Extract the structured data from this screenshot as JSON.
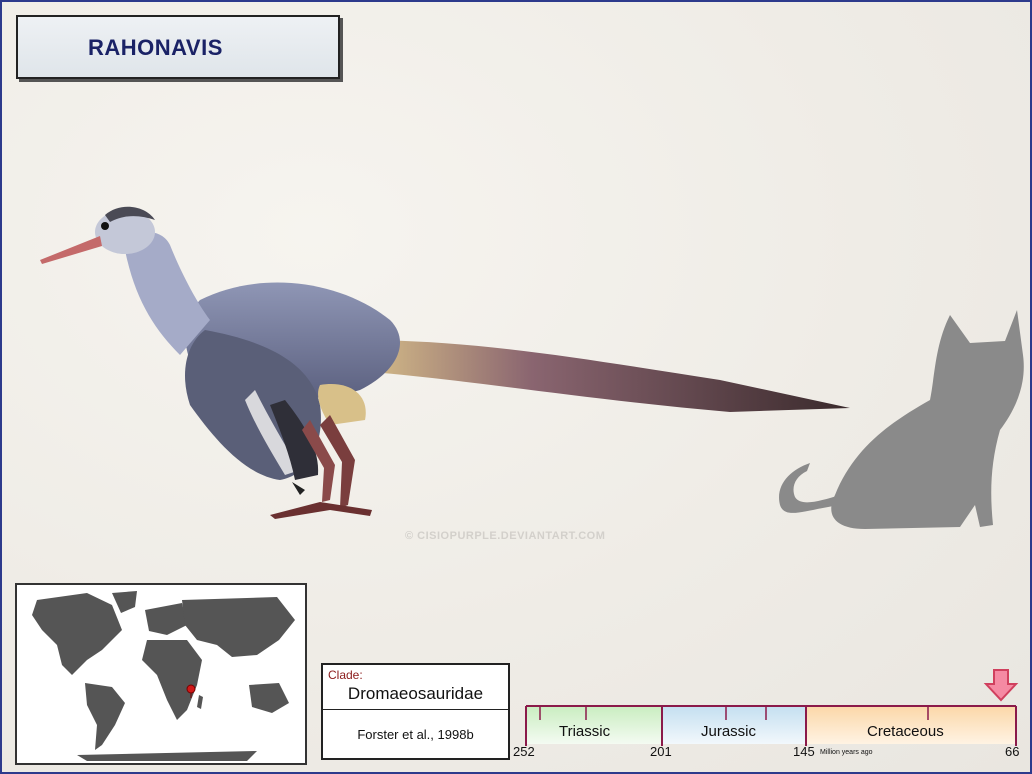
{
  "title": "RAHONAVIS",
  "watermark": "© CISIOPURPLE.DEVIANTART.COM",
  "clade": {
    "label": "Clade:",
    "name": "Dromaeosauridae",
    "reference": "Forster et al., 1998b"
  },
  "timeline": {
    "periods": [
      {
        "name": "Triassic",
        "start": 252,
        "end": 201,
        "color": "#c9edc0"
      },
      {
        "name": "Jurassic",
        "start": 201,
        "end": 145,
        "color": "#c4dff0"
      },
      {
        "name": "Cretaceous",
        "start": 145,
        "end": 66,
        "color": "#fbd7a8"
      }
    ],
    "ticks": [
      "252",
      "201",
      "145",
      "66"
    ],
    "unit_label": "Million years ago",
    "marker_ma": 68
  },
  "colors": {
    "frame": "#2d3a8c",
    "timeline_axis": "#8b1a4a",
    "marker": "#f06a8a",
    "location_dot": "#d01818",
    "land": "#555555",
    "silhouette": "#8a8a8a"
  }
}
